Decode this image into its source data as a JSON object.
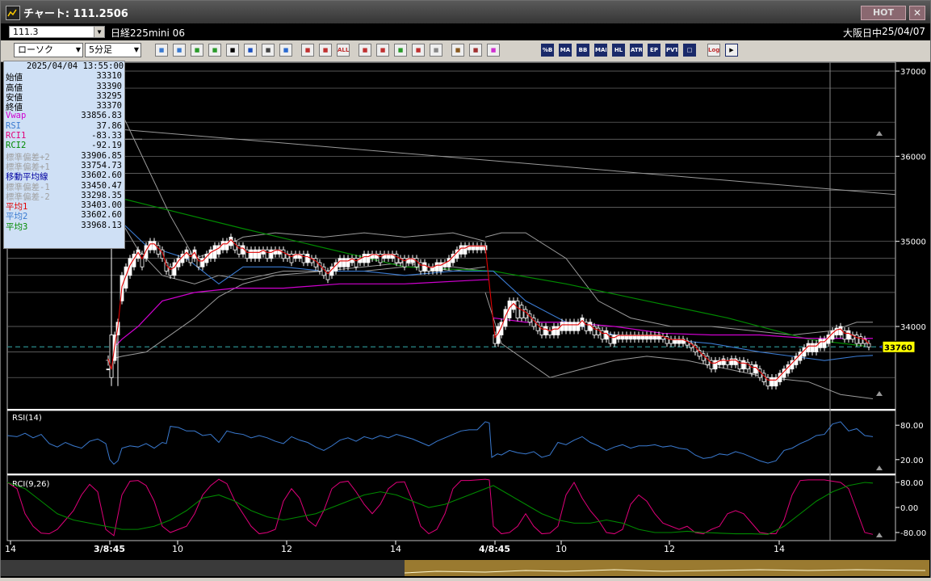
{
  "window": {
    "title": "チャート: 111.2506",
    "hot_label": "HOT",
    "close_label": "✕"
  },
  "infobar": {
    "symbol": "111.3",
    "instrument": "日経225mini 06",
    "market": "大阪日中",
    "date": "25/04/07"
  },
  "toolbar": {
    "chart_type": "ローソク",
    "interval": "5分足",
    "buttons": [
      "search-icon",
      "grid-icon",
      "pen-icon",
      "line-icon",
      "cursor-icon",
      "pointer-icon",
      "page-icon",
      "trash-icon",
      "candle-icon",
      "compare-icon",
      "ALL",
      "marker-icon",
      "zoom-icon",
      "bar-icon",
      "arrow-icon",
      "clock-icon",
      "settings-icon",
      "tools-icon",
      "color-icon"
    ],
    "indicator_buttons": [
      "%B",
      "MA",
      "BB",
      "MAE",
      "HL",
      "ATR",
      "EP",
      "PVT",
      "□",
      "Log",
      "exit-icon"
    ]
  },
  "data_panel": {
    "datetime": "2025/04/04  13:55:00",
    "rows": [
      {
        "label": "始値",
        "value": "33310",
        "color": "#000000"
      },
      {
        "label": "高値",
        "value": "33390",
        "color": "#000000"
      },
      {
        "label": "安値",
        "value": "33295",
        "color": "#000000"
      },
      {
        "label": "終値",
        "value": "33370",
        "color": "#000000"
      },
      {
        "label": "Vwap",
        "value": "33856.83",
        "color": "#d000d0"
      },
      {
        "label": "RSI",
        "value": "37.86",
        "color": "#3a7ad0"
      },
      {
        "label": "RCI1",
        "value": "-83.33",
        "color": "#e0007a"
      },
      {
        "label": "RCI2",
        "value": "-92.19",
        "color": "#008a00"
      },
      {
        "label": "標準偏差+2",
        "value": "33906.85",
        "color": "#a0a0a0"
      },
      {
        "label": "標準偏差+1",
        "value": "33754.73",
        "color": "#a0a0a0"
      },
      {
        "label": "移動平均線",
        "value": "33602.60",
        "color": "#0000a0"
      },
      {
        "label": "標準偏差-1",
        "value": "33450.47",
        "color": "#a0a0a0"
      },
      {
        "label": "標準偏差-2",
        "value": "33298.35",
        "color": "#a0a0a0"
      },
      {
        "label": "平均1",
        "value": "33403.00",
        "color": "#e00000"
      },
      {
        "label": "平均2",
        "value": "33602.60",
        "color": "#3a7ad0"
      },
      {
        "label": "平均3",
        "value": "33968.13",
        "color": "#008a00"
      }
    ]
  },
  "price_axis": {
    "ticks": [
      "37000",
      "36000",
      "35000",
      "34000"
    ],
    "current_price": "33760"
  },
  "rsi_panel": {
    "label": "RSI(14)",
    "ticks": [
      "80.00",
      "20.00"
    ]
  },
  "rci_panel": {
    "label": "RCI(9,26)",
    "ticks": [
      "80.00",
      "0.00",
      "-80.00"
    ]
  },
  "time_axis": {
    "ticks": [
      "14",
      "3/8:45",
      "10",
      "12",
      "14",
      "4/8:45",
      "10",
      "12",
      "14"
    ]
  },
  "colors": {
    "ma1": "#e00000",
    "ma2": "#3a7ad0",
    "ma3": "#008a00",
    "vwap": "#d000d0",
    "bands": "#a0a0a0",
    "current": "#ffff00",
    "dash": "#2a8a8a"
  }
}
